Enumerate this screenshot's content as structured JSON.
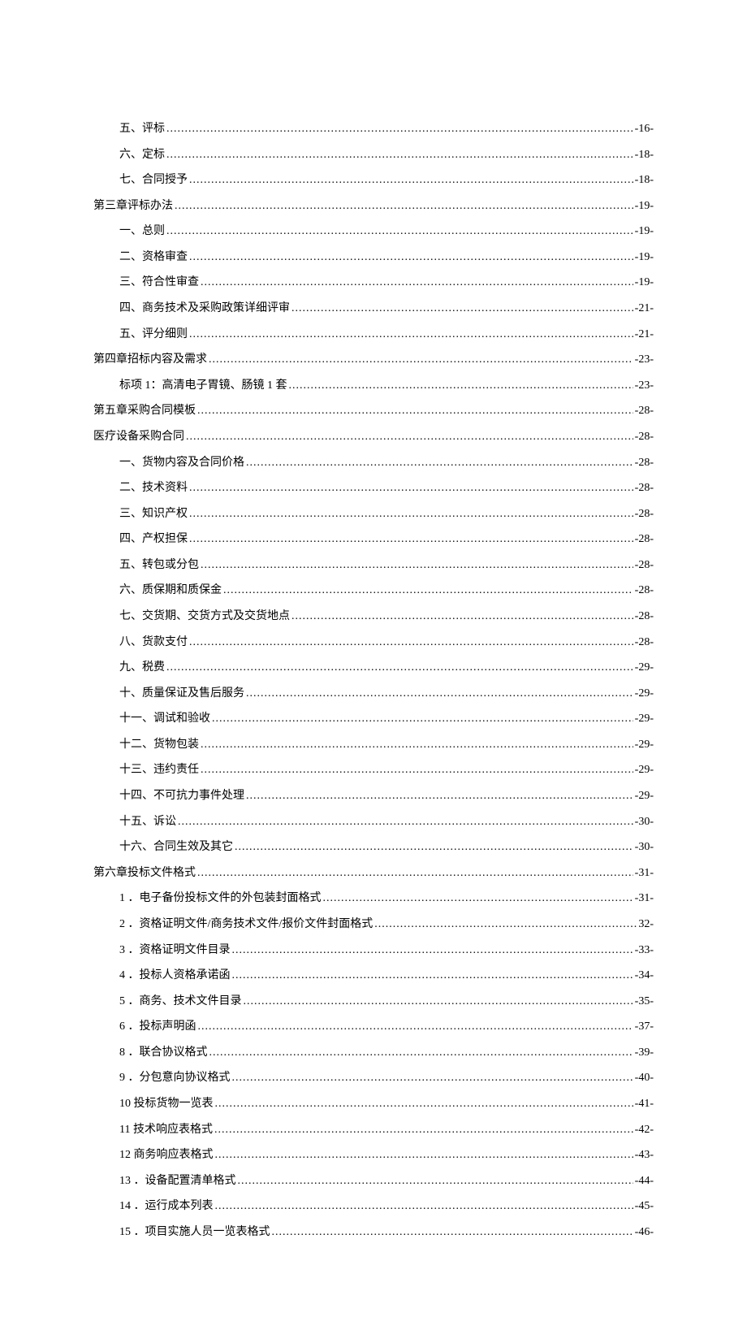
{
  "toc": [
    {
      "indent": 1,
      "label": "五、评标",
      "page": "-16-"
    },
    {
      "indent": 1,
      "label": "六、定标",
      "page": "-18-"
    },
    {
      "indent": 1,
      "label": "七、合同授予",
      "page": "-18-"
    },
    {
      "indent": 0,
      "label": "第三章评标办法",
      "page": "-19-"
    },
    {
      "indent": 1,
      "label": "一、总则",
      "page": "-19-"
    },
    {
      "indent": 1,
      "label": "二、资格审查",
      "page": "-19-"
    },
    {
      "indent": 1,
      "label": "三、符合性审查",
      "page": "-19-"
    },
    {
      "indent": 1,
      "label": "四、商务技术及采购政策详细评审",
      "page": "-21-"
    },
    {
      "indent": 1,
      "label": "五、评分细则",
      "page": "-21-"
    },
    {
      "indent": 0,
      "label": "第四章招标内容及需求",
      "page": "-23-"
    },
    {
      "indent": 1,
      "label": "标项 1：高清电子胃镜、肠镜 1 套",
      "page": "-23-"
    },
    {
      "indent": 0,
      "label": "第五章采购合同模板",
      "page": "-28-"
    },
    {
      "indent": 0,
      "label": "医疗设备采购合同",
      "page": "-28-"
    },
    {
      "indent": 1,
      "label": "一、货物内容及合同价格",
      "page": "-28-"
    },
    {
      "indent": 1,
      "label": "二、技术资料",
      "page": "-28-"
    },
    {
      "indent": 1,
      "label": "三、知识产权",
      "page": "-28-"
    },
    {
      "indent": 1,
      "label": "四、产权担保",
      "page": "-28-"
    },
    {
      "indent": 1,
      "label": "五、转包或分包",
      "page": "-28-"
    },
    {
      "indent": 1,
      "label": "六、质保期和质保金",
      "page": "-28-"
    },
    {
      "indent": 1,
      "label": "七、交货期、交货方式及交货地点",
      "page": "-28-"
    },
    {
      "indent": 1,
      "label": "八、货款支付",
      "page": "-28-"
    },
    {
      "indent": 1,
      "label": "九、税费",
      "page": "-29-"
    },
    {
      "indent": 1,
      "label": "十、质量保证及售后服务",
      "page": "-29-"
    },
    {
      "indent": 1,
      "label": "十一、调试和验收",
      "page": "-29-"
    },
    {
      "indent": 1,
      "label": "十二、货物包装",
      "page": "-29-"
    },
    {
      "indent": 1,
      "label": "十三、违约责任",
      "page": "-29-"
    },
    {
      "indent": 1,
      "label": "十四、不可抗力事件处理",
      "page": "-29-"
    },
    {
      "indent": 1,
      "label": "十五、诉讼",
      "page": "-30-"
    },
    {
      "indent": 1,
      "label": "十六、合同生效及其它",
      "page": "-30-"
    },
    {
      "indent": 0,
      "label": "第六章投标文件格式",
      "page": "-31-"
    },
    {
      "indent": 1,
      "label": "1 ．电子备份投标文件的外包装封面格式",
      "page": "-31-"
    },
    {
      "indent": 1,
      "label": "2 ．资格证明文件/商务技术文件/报价文件封面格式",
      "page": "32-"
    },
    {
      "indent": 1,
      "label": "3 ．资格证明文件目录",
      "page": "-33-"
    },
    {
      "indent": 1,
      "label": "4 ．投标人资格承诺函",
      "page": "-34-"
    },
    {
      "indent": 1,
      "label": "5 ．商务、技术文件目录",
      "page": "-35-"
    },
    {
      "indent": 1,
      "label": "6 ．投标声明函",
      "page": "-37-"
    },
    {
      "indent": 1,
      "label": "8 ．联合协议格式",
      "page": "-39-"
    },
    {
      "indent": 1,
      "label": "9 ．分包意向协议格式",
      "page": "-40-"
    },
    {
      "indent": 1,
      "label": "10  投标货物一览表",
      "page": "-41-"
    },
    {
      "indent": 1,
      "label": "11  技术响应表格式",
      "page": "-42-"
    },
    {
      "indent": 1,
      "label": "12  商务响应表格式",
      "page": "-43-"
    },
    {
      "indent": 1,
      "label": "13 ．设备配置清单格式",
      "page": "-44-"
    },
    {
      "indent": 1,
      "label": "14 ．运行成本列表",
      "page": "-45-"
    },
    {
      "indent": 1,
      "label": "15 ．项目实施人员一览表格式",
      "page": "-46-"
    }
  ]
}
